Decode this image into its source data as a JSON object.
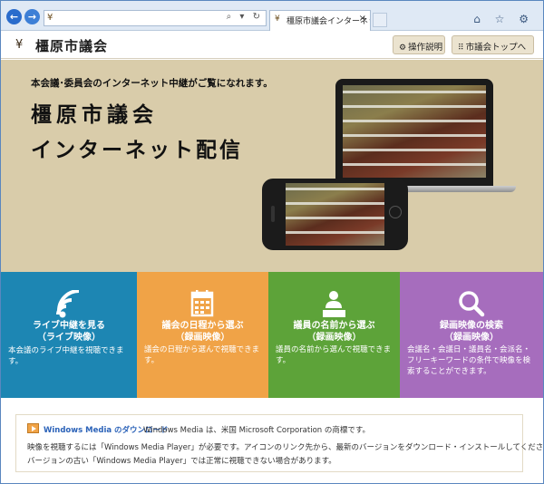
{
  "browser": {
    "back_glyph": "←",
    "forward_glyph": "→",
    "site_icon_glyph": "¥",
    "address_tools": "⌕ ▾ ↻",
    "tab_title": "橿原市議会インターネット議...",
    "tab_close": "×",
    "right_icons": "⌂ ☆ ⚙"
  },
  "header": {
    "logo_mark": "¥",
    "logo_text": "橿原市議会",
    "help_icon": "⚙",
    "help_label": "操作説明",
    "top_icon": "⠿",
    "top_label": "市議会トップへ"
  },
  "hero": {
    "subtitle": "本会議･委員会のインターネット中継がご覧になれます。",
    "title_line1": "橿原市議会",
    "title_line2": "インターネット配信"
  },
  "tiles": [
    {
      "title1": "ライブ中継を見る",
      "title2": "（ライブ映像）",
      "desc": "本会議のライブ中継を視聴できます。",
      "icon": "wifi-signal-icon",
      "color": "#1d86b3"
    },
    {
      "title1": "議会の日程から選ぶ",
      "title2": "（録画映像）",
      "desc": "議会の日程から選んで視聴できます。",
      "icon": "calendar-icon",
      "color": "#f0a347"
    },
    {
      "title1": "議員の名前から選ぶ",
      "title2": "（録画映像）",
      "desc": "議員の名前から選んで視聴できます。",
      "icon": "speaker-podium-icon",
      "color": "#5da339"
    },
    {
      "title1": "録画映像の検索",
      "title2": "（録画映像）",
      "desc": "会議名・会議日・議員名・会派名・フリーキーワードの条件で映像を検索することができます。",
      "icon": "magnifier-icon",
      "color": "#a66dbd"
    }
  ],
  "info": {
    "link_text": "Windows Media のダウンロード",
    "note": "Windows Media は、米国 Microsoft Corporation の商標です。",
    "line2": "映像を視聴するには「Windows Media Player」が必要です。アイコンのリンク先から、最新のバージョンをダウンロード・インストールしてください。",
    "line3": "バージョンの古い「Windows Media Player」では正常に視聴できない場合があります。"
  }
}
